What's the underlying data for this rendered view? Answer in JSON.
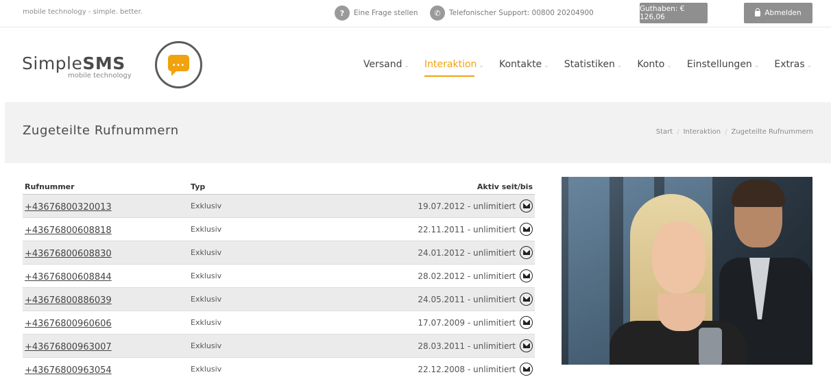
{
  "topbar": {
    "tagline": "mobile technology - simple. better.",
    "help_label": "Eine Frage stellen",
    "help_icon": "question-icon",
    "support_label": "Telefonischer Support: 00800 20204900",
    "support_icon": "phone-icon",
    "credit_label": "Guthaben: € 126,06",
    "logout_label": "Abmelden",
    "logout_icon": "lock-icon"
  },
  "logo": {
    "brand_light": "Simple",
    "brand_bold": "SMS",
    "subtitle": "mobile technology",
    "bubble_text": "...",
    "accent_color": "#f0a20f"
  },
  "nav": {
    "items": [
      {
        "label": "Versand",
        "active": false
      },
      {
        "label": "Interaktion",
        "active": true
      },
      {
        "label": "Kontakte",
        "active": false
      },
      {
        "label": "Statistiken",
        "active": false
      },
      {
        "label": "Konto",
        "active": false
      },
      {
        "label": "Einstellungen",
        "active": false
      },
      {
        "label": "Extras",
        "active": false
      }
    ],
    "chevron": "⌄"
  },
  "page": {
    "title": "Zugeteilte Rufnummern",
    "breadcrumb": [
      "Start",
      "Interaktion",
      "Zugeteilte Rufnummern"
    ],
    "breadcrumb_sep": "/"
  },
  "table": {
    "headers": [
      "Rufnummer",
      "Typ",
      "Aktiv seit/bis"
    ],
    "rows": [
      {
        "number": "+43676800320013",
        "type": "Exklusiv",
        "active": "19.07.2012 - unlimitiert"
      },
      {
        "number": "+43676800608818",
        "type": "Exklusiv",
        "active": "22.11.2011 - unlimitiert"
      },
      {
        "number": "+43676800608830",
        "type": "Exklusiv",
        "active": "24.01.2012 - unlimitiert"
      },
      {
        "number": "+43676800608844",
        "type": "Exklusiv",
        "active": "28.02.2012 - unlimitiert"
      },
      {
        "number": "+43676800886039",
        "type": "Exklusiv",
        "active": "24.05.2011 - unlimitiert"
      },
      {
        "number": "+43676800960606",
        "type": "Exklusiv",
        "active": "17.07.2009 - unlimitiert"
      },
      {
        "number": "+43676800963007",
        "type": "Exklusiv",
        "active": "28.03.2011 - unlimitiert"
      },
      {
        "number": "+43676800963054",
        "type": "Exklusiv",
        "active": "22.12.2008 - unlimitiert"
      }
    ],
    "row_icon": "mail-icon"
  }
}
